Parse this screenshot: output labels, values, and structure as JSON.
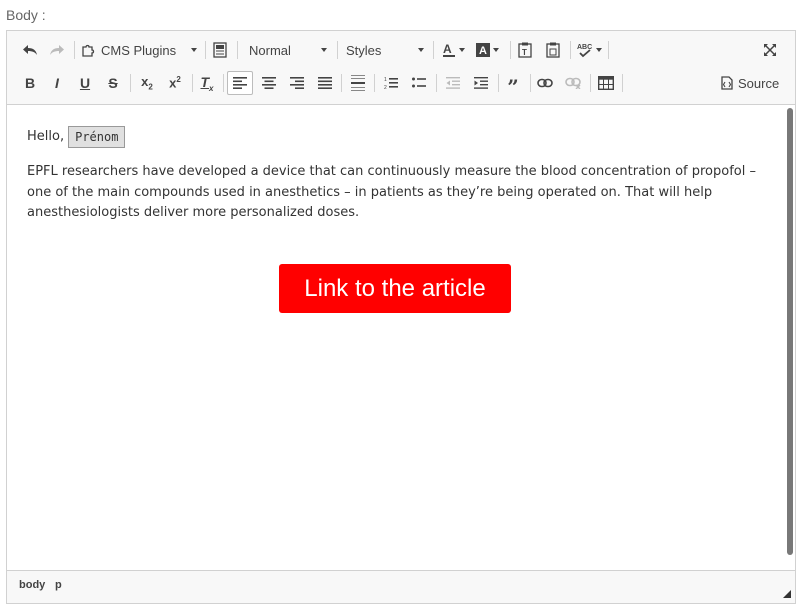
{
  "field": {
    "label": "Body :"
  },
  "toolbar": {
    "plugins_label": "CMS Plugins",
    "format_label": "Normal",
    "styles_label": "Styles",
    "source_label": "Source",
    "icons": [
      "undo-icon",
      "redo-icon",
      "puzzle-icon",
      "template-icon",
      "text-color-icon",
      "bg-color-icon",
      "paste-text-icon",
      "paste-word-icon",
      "spellcheck-icon",
      "maximize-icon",
      "bold-icon",
      "italic-icon",
      "underline-icon",
      "strike-icon",
      "subscript-icon",
      "superscript-icon",
      "remove-format-icon",
      "align-left-icon",
      "align-center-icon",
      "align-right-icon",
      "justify-icon",
      "hr-icon",
      "numbered-list-icon",
      "bullet-list-icon",
      "outdent-icon",
      "indent-icon",
      "blockquote-icon",
      "link-icon",
      "unlink-icon",
      "table-icon",
      "source-icon"
    ]
  },
  "content": {
    "greeting": "Hello,",
    "placeholder": "Prénom",
    "paragraph": "EPFL researchers have developed a device that can continuously measure the blood concentration of propofol – one of the main compounds used in anesthetics – in patients as they’re being operated on. That will help anesthesiologists deliver more personalized doses.",
    "button_label": "Link to the article",
    "button_color": "#ff0000"
  },
  "statusbar": {
    "crumbs": [
      "body",
      "p"
    ]
  }
}
